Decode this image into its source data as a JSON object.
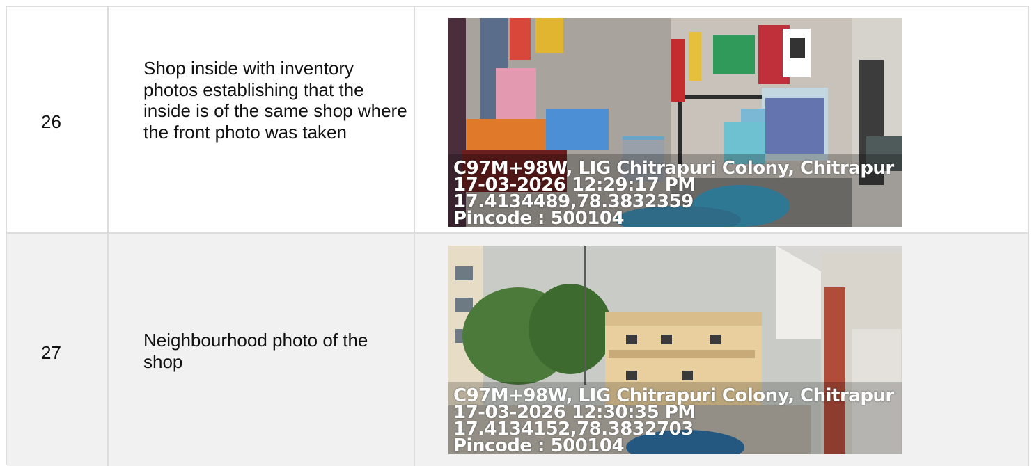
{
  "rows": [
    {
      "number": "26",
      "description": "Shop inside with inventory photos establishing that the inside is of the same shop where the front photo was taken",
      "photo": {
        "icon": "shop-inventory-photo",
        "stamp": {
          "address": "C97M+98W, LIG Chitrapuri Colony, Chitrapur",
          "datetime": "17-03-2026 12:29:17 PM",
          "coords": "17.4134489,78.3832359",
          "pincode": "Pincode : 500104"
        }
      }
    },
    {
      "number": "27",
      "description": "Neighbourhood photo of the shop",
      "photo": {
        "icon": "neighbourhood-photo",
        "stamp": {
          "address": "C97M+98W, LIG Chitrapuri Colony, Chitrapur",
          "datetime": "17-03-2026 12:30:35 PM",
          "coords": "17.4134152,78.3832703",
          "pincode": "Pincode : 500104"
        }
      }
    }
  ],
  "colors": {
    "border": "#dcdcdc",
    "row_alt_bg": "#f1f1f1"
  }
}
